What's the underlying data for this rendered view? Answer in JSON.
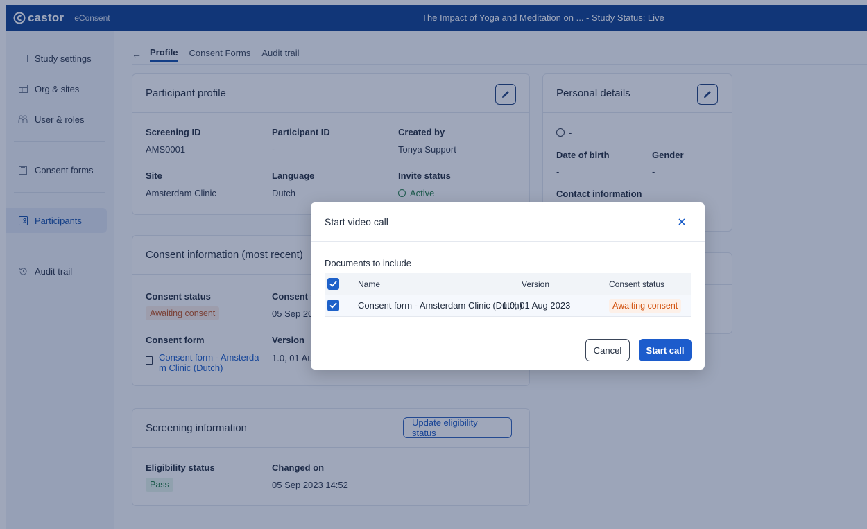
{
  "topbar": {
    "brand": "castor",
    "product": "eConsent",
    "study_title": "The Impact of Yoga and Meditation on ...  - Study Status: Live"
  },
  "sidebar": {
    "items": [
      {
        "label": "Study settings",
        "icon": "folder-icon"
      },
      {
        "label": "Org & sites",
        "icon": "building-icon"
      },
      {
        "label": "User & roles",
        "icon": "users-icon"
      },
      {
        "label": "Consent forms",
        "icon": "clipboard-icon"
      },
      {
        "label": "Participants",
        "icon": "participants-icon",
        "active": true
      },
      {
        "label": "Audit trail",
        "icon": "history-icon"
      }
    ]
  },
  "tabs": {
    "items": [
      "Profile",
      "Consent Forms",
      "Audit trail"
    ],
    "active": "Profile"
  },
  "participant_profile": {
    "title": "Participant profile",
    "screening_id_label": "Screening ID",
    "screening_id": "AMS0001",
    "participant_id_label": "Participant ID",
    "participant_id": "-",
    "created_by_label": "Created by",
    "created_by": "Tonya Support",
    "site_label": "Site",
    "site": "Amsterdam Clinic",
    "language_label": "Language",
    "language": "Dutch",
    "invite_status_label": "Invite status",
    "invite_status": "Active"
  },
  "personal_details": {
    "title": "Personal details",
    "name": "-",
    "dob_label": "Date of birth",
    "dob": "-",
    "gender_label": "Gender",
    "gender": "-",
    "contact_label": "Contact information"
  },
  "consent_info": {
    "title": "Consent information (most recent)",
    "status_label": "Consent status",
    "status": "Awaiting consent",
    "consent_for_label": "Consent fo",
    "consent_for": "05 Sep 20",
    "form_label": "Consent form",
    "form_link_line1": "Consent form - Amsterda",
    "form_link_line2": "m Clinic (Dutch)",
    "version_label": "Version",
    "version": "1.0, 01 Au"
  },
  "screening_info": {
    "title": "Screening information",
    "update_button": "Update eligibility status",
    "eligibility_label": "Eligibility status",
    "eligibility": "Pass",
    "changed_on_label": "Changed on",
    "changed_on": "05 Sep 2023 14:52"
  },
  "modal": {
    "title": "Start video call",
    "docs_title": "Documents to include",
    "columns": {
      "name": "Name",
      "version": "Version",
      "status": "Consent status"
    },
    "rows": [
      {
        "name": "Consent form - Amsterdam Clinic (Dutch)",
        "version": "1.0, 01 Aug 2023",
        "status": "Awaiting consent",
        "checked": true
      }
    ],
    "cancel": "Cancel",
    "start": "Start call"
  },
  "colors": {
    "topbar": "#0c3d8e",
    "primary": "#1c5ccc",
    "awaiting": "#d2520f",
    "pass": "#1f7a43"
  }
}
